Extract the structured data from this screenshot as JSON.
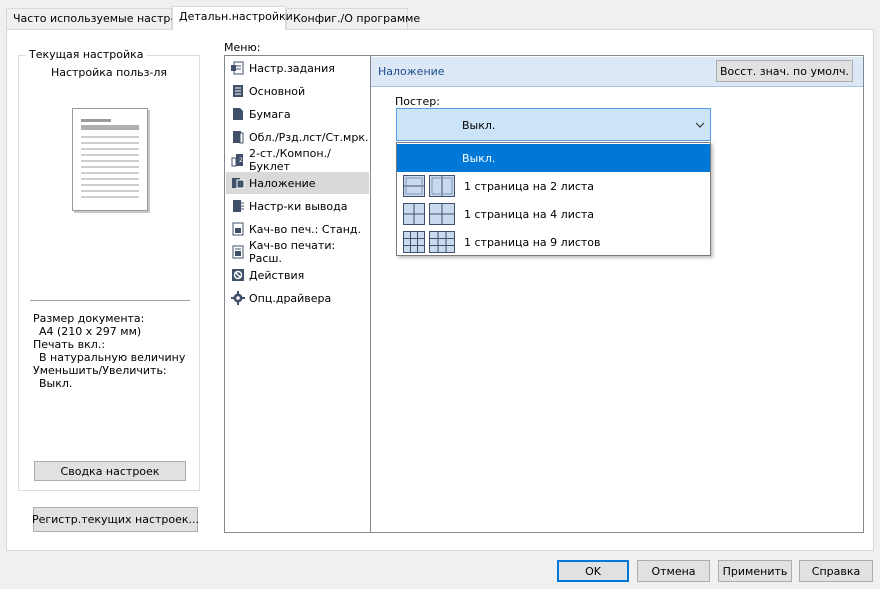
{
  "tabs": [
    {
      "label": "Часто используемые настр-ки"
    },
    {
      "label": "Детальн.настройки"
    },
    {
      "label": "Конфиг./О программе"
    }
  ],
  "current_setting": {
    "group_title": "Текущая настройка",
    "name": "Настройка польз-ля",
    "info": {
      "doc_size_label": "Размер документа:",
      "doc_size_value": "A4 (210 x 297 мм)",
      "print_on_label": "Печать вкл.:",
      "print_on_value": "В натуральную величину",
      "reduce_label": "Уменьшить/Увеличить:",
      "reduce_value": "Выкл."
    },
    "summary_button": "Сводка настроек"
  },
  "register_button": "Регистр.текущих настроек...",
  "menu": {
    "label": "Меню:",
    "items": [
      {
        "label": "Настр.задания",
        "icon": "job-settings-icon"
      },
      {
        "label": "Основной",
        "icon": "basic-icon"
      },
      {
        "label": "Бумага",
        "icon": "paper-icon"
      },
      {
        "label": "Обл./Рзд.лст/Ст.мрк.",
        "icon": "cover-icon"
      },
      {
        "label": "2-ст./Компон./Буклет",
        "icon": "duplex-icon"
      },
      {
        "label": "Наложение",
        "icon": "overlay-icon"
      },
      {
        "label": "Настр-ки вывода",
        "icon": "output-icon"
      },
      {
        "label": "Кач-во печ.: Станд.",
        "icon": "quality-standard-icon"
      },
      {
        "label": "Кач-во печати: Расш.",
        "icon": "quality-advanced-icon"
      },
      {
        "label": "Действия",
        "icon": "actions-icon"
      },
      {
        "label": "Опц.драйвера",
        "icon": "driver-options-icon"
      }
    ],
    "selected_index": 5
  },
  "panel": {
    "title": "Наложение",
    "restore_button": "Восст. знач. по умолч.",
    "poster_label": "Постер:",
    "poster_value": "Выкл.",
    "poster_options": [
      {
        "label": "Выкл.",
        "grid": "none"
      },
      {
        "label": "1 страница на 2 листа",
        "grid": "2"
      },
      {
        "label": "1 страница на 4 листа",
        "grid": "4"
      },
      {
        "label": "1 страница на 9 листов",
        "grid": "9"
      }
    ]
  },
  "footer": {
    "ok": "OK",
    "cancel": "Отмена",
    "apply": "Применить",
    "help": "Справка"
  },
  "colors": {
    "highlight": "#0078d7",
    "header_bar": "#dce8f5",
    "header_text": "#1e4a8c",
    "dropdown_bg": "#cce4f7"
  }
}
